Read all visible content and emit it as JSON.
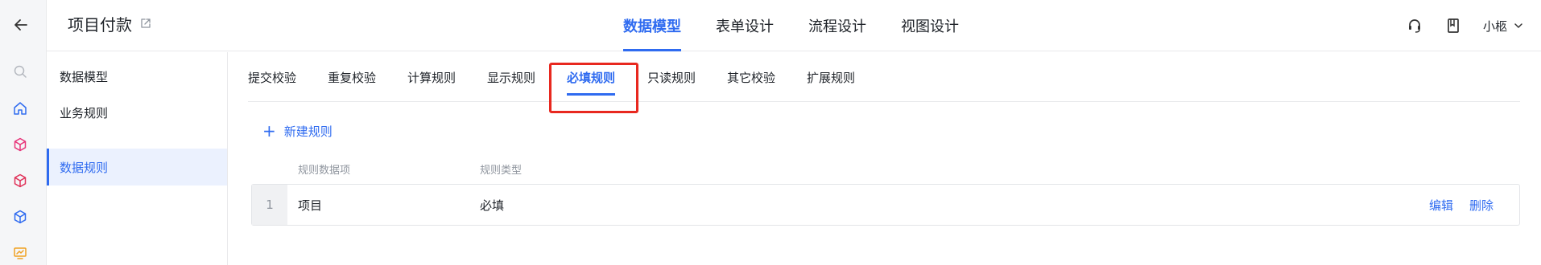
{
  "app": {
    "title": "项目付款"
  },
  "top_tabs": [
    {
      "label": "数据模型",
      "active": true
    },
    {
      "label": "表单设计",
      "active": false
    },
    {
      "label": "流程设计",
      "active": false
    },
    {
      "label": "视图设计",
      "active": false
    }
  ],
  "user": {
    "name": "小柩"
  },
  "sidenav": [
    {
      "label": "数据模型",
      "active": false
    },
    {
      "label": "业务规则",
      "active": false
    },
    {
      "label": "数据规则",
      "active": true
    }
  ],
  "sub_tabs": [
    {
      "label": "提交校验",
      "active": false
    },
    {
      "label": "重复校验",
      "active": false
    },
    {
      "label": "计算规则",
      "active": false
    },
    {
      "label": "显示规则",
      "active": false
    },
    {
      "label": "必填规则",
      "active": true
    },
    {
      "label": "只读规则",
      "active": false
    },
    {
      "label": "其它校验",
      "active": false
    },
    {
      "label": "扩展规则",
      "active": false
    }
  ],
  "new_rule": {
    "label": "新建规则"
  },
  "table": {
    "columns": [
      "规则数据项",
      "规则类型"
    ],
    "rows": [
      {
        "index": "1",
        "item": "项目",
        "type": "必填",
        "edit": "编辑",
        "delete": "删除"
      }
    ]
  },
  "colors": {
    "accent": "#2f6bf0",
    "highlight": "#e8281f"
  }
}
